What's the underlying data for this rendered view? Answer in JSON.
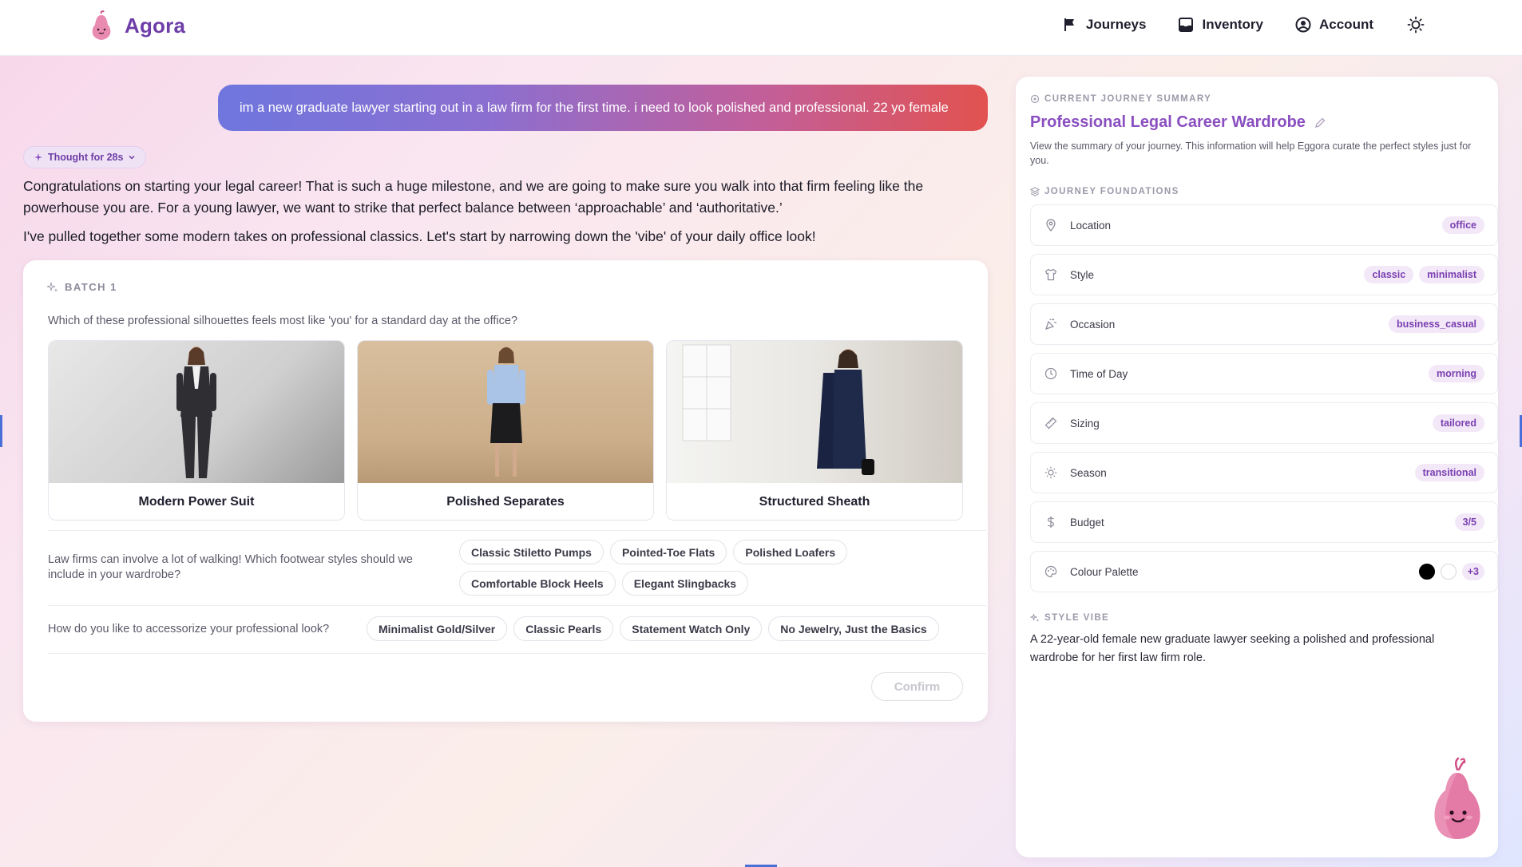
{
  "app": {
    "name": "Agora"
  },
  "nav": {
    "journeys": "Journeys",
    "inventory": "Inventory",
    "account": "Account"
  },
  "chat": {
    "user_message": "im a new graduate lawyer starting out in a law firm for the first time. i need to look polished and professional. 22 yo female",
    "thought_label": "Thought for 28s",
    "assistant_paragraphs": [
      "Congratulations on starting your legal career! That is such a huge milestone, and we are going to make sure you walk into that firm feeling like the powerhouse you are. For a young lawyer, we want to strike that perfect balance between ‘approachable’ and ‘authoritative.’",
      "I've pulled together some modern takes on professional classics. Let's start by narrowing down the 'vibe' of your daily office look!"
    ]
  },
  "batch": {
    "label": "BATCH 1",
    "q1": "Which of these professional silhouettes feels most like 'you' for a standard day at the office?",
    "options": [
      "Modern Power Suit",
      "Polished Separates",
      "Structured Sheath"
    ],
    "q2": "Law firms can involve a lot of walking! Which footwear styles should we include in your wardrobe?",
    "footwear": [
      "Classic Stiletto Pumps",
      "Pointed-Toe Flats",
      "Polished Loafers",
      "Comfortable Block Heels",
      "Elegant Slingbacks"
    ],
    "q3": "How do you like to accessorize your professional look?",
    "accessories": [
      "Minimalist Gold/Silver",
      "Classic Pearls",
      "Statement Watch Only",
      "No Jewelry, Just the Basics"
    ],
    "confirm": "Confirm"
  },
  "summary": {
    "section_label": "CURRENT JOURNEY SUMMARY",
    "title": "Professional Legal Career Wardrobe",
    "description": "View the summary of your journey. This information will help Eggora curate the perfect styles just for you.",
    "foundations_label": "JOURNEY FOUNDATIONS",
    "rows": [
      {
        "label": "Location",
        "tags": [
          "office"
        ],
        "icon": "map-pin-icon"
      },
      {
        "label": "Style",
        "tags": [
          "classic",
          "minimalist"
        ],
        "icon": "shirt-icon"
      },
      {
        "label": "Occasion",
        "tags": [
          "business_casual"
        ],
        "icon": "party-icon"
      },
      {
        "label": "Time of Day",
        "tags": [
          "morning"
        ],
        "icon": "clock-icon"
      },
      {
        "label": "Sizing",
        "tags": [
          "tailored"
        ],
        "icon": "ruler-icon"
      },
      {
        "label": "Season",
        "tags": [
          "transitional"
        ],
        "icon": "sun-icon"
      },
      {
        "label": "Budget",
        "tags": [
          "3/5"
        ],
        "icon": "dollar-icon"
      },
      {
        "label": "Colour Palette",
        "more": "+3",
        "swatches": [
          "#000000",
          "#ffffff"
        ],
        "icon": "palette-icon"
      }
    ],
    "vibe_label": "STYLE VIBE",
    "vibe_text": "A 22-year-old female new graduate lawyer seeking a polished and professional wardrobe for her first law firm role."
  }
}
